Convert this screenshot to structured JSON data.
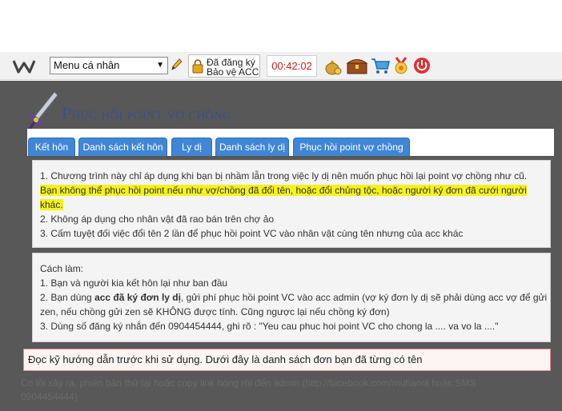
{
  "topbar": {
    "logo_icon": "w-logo-icon",
    "menu_select_value": "Menu cá nhân",
    "pencil_icon": "pencil-icon",
    "register_line1": "Đã đăng ký",
    "register_line2": "Bảo vệ ACC",
    "timer": "00:42:02",
    "icons": [
      "money-bag-icon",
      "treasure-chest-icon",
      "shopping-cart-icon",
      "medal-icon",
      "power-icon"
    ]
  },
  "page": {
    "title": "Phục hồi point vợ chồng",
    "tabs": [
      "Kết hôn",
      "Danh sách kết hôn",
      "Ly dị",
      "Danh sách ly dị",
      "Phục hồi point vợ chồng"
    ]
  },
  "notice": {
    "line1": "1. Chương trình này chỉ áp dụng khi bạn bị nhầm lẫn trong việc ly dị nên muốn phục hồi lại point vợ chồng như cũ.",
    "line2": "Bạn không thể phục hồi point nếu như vợ/chồng đã đổi tên, hoặc đổi chủng tộc, hoặc người ký đơn đã cưới người",
    "line3": "khác.",
    "line4": "2. Không áp dụng cho nhân vật đã rao bán trên chợ ảo",
    "line5": "3. Cấm tuyệt đối việc đổi tên 2 lần để phục hồi point VC vào nhân vật cùng tên nhưng của acc khác"
  },
  "howto": {
    "heading": "Cách làm:",
    "step1": "1. Bạn và người kia kết hôn lại như ban đầu",
    "step2_prefix": "2. Bạn dùng ",
    "step2_bold": "acc đã ký đơn ly dị",
    "step2_suffix": ", gửi phí phục hồi point VC vào acc admin (vợ ký đơn ly dị sẽ phải dùng acc vợ để gửi",
    "step2_cont": "zen, nếu chồng gửi zen sẽ KHÔNG được tính. Cũng ngược lại nếu chồng ký đơn)",
    "step3": "3. Dùng số đăng ký nhắn đến 0904454444, ghi rõ : \"Yeu cau phuc hoi point VC cho chong la .... va vo la ....\""
  },
  "alert": "Đọc kỹ hướng dẫn trước khi sử dụng. Dưới đây là danh sách đơn bạn đã từng có tên",
  "footer": {
    "line1": "Có lỗi xảy ra, phiên bản thử lại hoặc copy link hỏng rồi đến admin (http://facebook.com/muhanoi hoặc SMS",
    "line2": "0904454444)"
  }
}
